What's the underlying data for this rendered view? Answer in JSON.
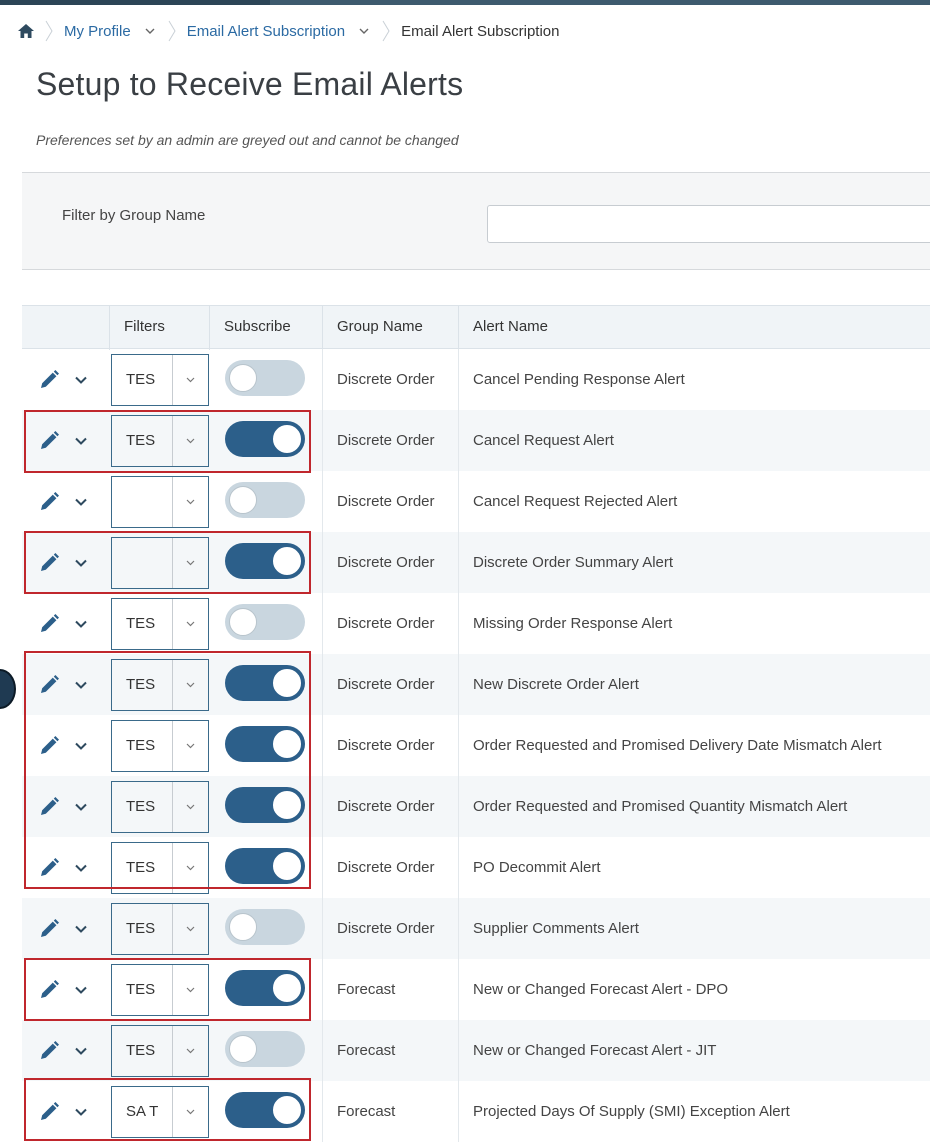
{
  "breadcrumb": {
    "home_icon": "home-icon",
    "items": [
      {
        "label": "My Profile",
        "has_dropdown": true
      },
      {
        "label": "Email Alert Subscription",
        "has_dropdown": true
      },
      {
        "label": "Email Alert Subscription",
        "has_dropdown": false
      }
    ]
  },
  "page": {
    "title": "Setup to Receive Email Alerts",
    "subtitle": "Preferences set by an admin are greyed out and cannot be changed"
  },
  "filter": {
    "label": "Filter by Group Name",
    "value": "",
    "placeholder": ""
  },
  "table": {
    "headers": {
      "filters": "Filters",
      "subscribe": "Subscribe",
      "group": "Group Name",
      "alert": "Alert Name"
    },
    "rows": [
      {
        "filter": "TES",
        "subscribed": false,
        "group": "Discrete Order",
        "alert": "Cancel Pending Response Alert"
      },
      {
        "filter": "TES",
        "subscribed": true,
        "group": "Discrete Order",
        "alert": "Cancel Request Alert"
      },
      {
        "filter": "",
        "subscribed": false,
        "group": "Discrete Order",
        "alert": "Cancel Request Rejected Alert"
      },
      {
        "filter": "",
        "subscribed": true,
        "group": "Discrete Order",
        "alert": "Discrete Order Summary Alert"
      },
      {
        "filter": "TES",
        "subscribed": false,
        "group": "Discrete Order",
        "alert": "Missing Order Response Alert"
      },
      {
        "filter": "TES",
        "subscribed": true,
        "group": "Discrete Order",
        "alert": "New Discrete Order Alert"
      },
      {
        "filter": "TES",
        "subscribed": true,
        "group": "Discrete Order",
        "alert": "Order Requested and Promised Delivery Date Mismatch Alert"
      },
      {
        "filter": "TES",
        "subscribed": true,
        "group": "Discrete Order",
        "alert": "Order Requested and Promised Quantity Mismatch Alert"
      },
      {
        "filter": "TES",
        "subscribed": true,
        "group": "Discrete Order",
        "alert": "PO Decommit Alert"
      },
      {
        "filter": "TES",
        "subscribed": false,
        "group": "Discrete Order",
        "alert": "Supplier Comments Alert"
      },
      {
        "filter": "TES",
        "subscribed": true,
        "group": "Forecast",
        "alert": "New or Changed Forecast Alert - DPO"
      },
      {
        "filter": "TES",
        "subscribed": false,
        "group": "Forecast",
        "alert": "New or Changed Forecast Alert - JIT"
      },
      {
        "filter": "SA T",
        "subscribed": true,
        "group": "Forecast",
        "alert": "Projected Days Of Supply (SMI) Exception Alert"
      }
    ]
  },
  "colors": {
    "accent": "#2c5f8a",
    "link": "#2b6aa3",
    "highlight": "#c0272d",
    "toggle_off": "#c9d6df"
  },
  "icons": {
    "edit": "pencil-icon",
    "expand": "chevron-down-icon",
    "select": "chevron-down-icon"
  }
}
